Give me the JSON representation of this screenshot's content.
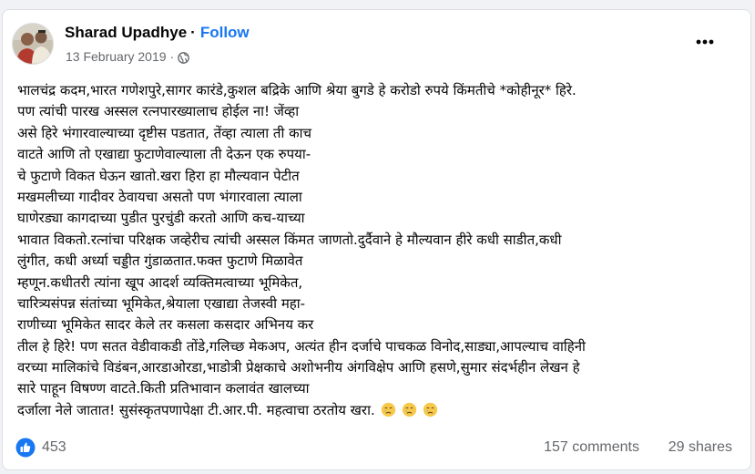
{
  "post": {
    "author": "Sharad Upadhye",
    "separator": "·",
    "follow_label": "Follow",
    "date": "13 February 2019",
    "meta_separator": "·",
    "audience_icon": "globe-icon",
    "more_icon": "more-options-icon",
    "body_lines": [
      "भालचंद्र कदम,भारत गणेशपुरे,सागर कारंडे,कुशल बद्रिके आणि श्रेया बुगडे हे करोडो रुपये किंमतीचे *कोहीनूर* हिरे.",
      "पण त्यांची पारख अस्सल रत्नपारख्यालाच होईल ना! जेंव्हा",
      "असे हिरे भंगारवाल्याच्या दृष्टीस पडतात, तेंव्हा त्याला ती काच",
      "वाटते आणि तो एखाद्या फुटाणेवाल्याला ती देऊन एक रुपया-",
      "चे फुटाणे विकत घेऊन खातो.खरा हिरा हा मौल्यवान पेटीत",
      "मखमलीच्या गादीवर ठेवायचा असतो पण भंगारवाला त्याला",
      "घाणेरड्या कागदाच्या पुडीत पुरचुंडी करतो आणि कच-याच्या",
      "भावात विकतो.रत्नांचा परिक्षक जव्हेरीच त्यांची अस्सल किंमत जाणतो.दुर्दैवाने हे मौल्यवान हीरे कधी साडीत,कधी",
      "लुंगीत, कधी अर्ध्या चड्डीत गुंडाळतात.फक्त फुटाणे मिळावेत",
      "म्हणून.कधीतरी त्यांना खूप आदर्श व्यक्तिमत्वाच्या भूमिकेत,",
      "चारित्र्यसंपन्न संतांच्या भूमिकेत,श्रेयाला एखाद्या तेजस्वी महा-",
      "राणीच्या भूमिकेत सादर केले तर कसला कसदार अभिनय कर",
      "तील हे हिरे! पण सतत वेडीवाकडी तोंडे,गलिच्छ मेकअप, अत्यंत हीन दर्जाचे पाचकळ विनोद,साड्या,आपल्याच वाहिनी",
      "वरच्या मालिकांचे विडंबन,आरडाओरडा,भाडोत्री प्रेक्षकाचे अशोभनीय अंगविक्षेप आणि हसणे,सुमार संदर्भहीन लेखन हे",
      "सारे पाहून विषण्ण वाटते.किती प्रतिभावान कलावंत खालच्या",
      "दर्जाला नेले जातात! सुसंस्कृतपणापेक्षा टी.आर.पी. महत्वाचा ठरतोय खरा."
    ],
    "trailing_emojis": [
      "crying-face-emoji",
      "crying-face-emoji",
      "crying-face-emoji"
    ]
  },
  "reactions": {
    "icon": "like-icon",
    "count": "453",
    "comments": "157 comments",
    "shares": "29 shares"
  },
  "colors": {
    "accent": "#1877f2",
    "secondary_text": "#65676b",
    "primary_text": "#050505",
    "background": "#f0f2f5",
    "emoji": "#f7c94a"
  }
}
